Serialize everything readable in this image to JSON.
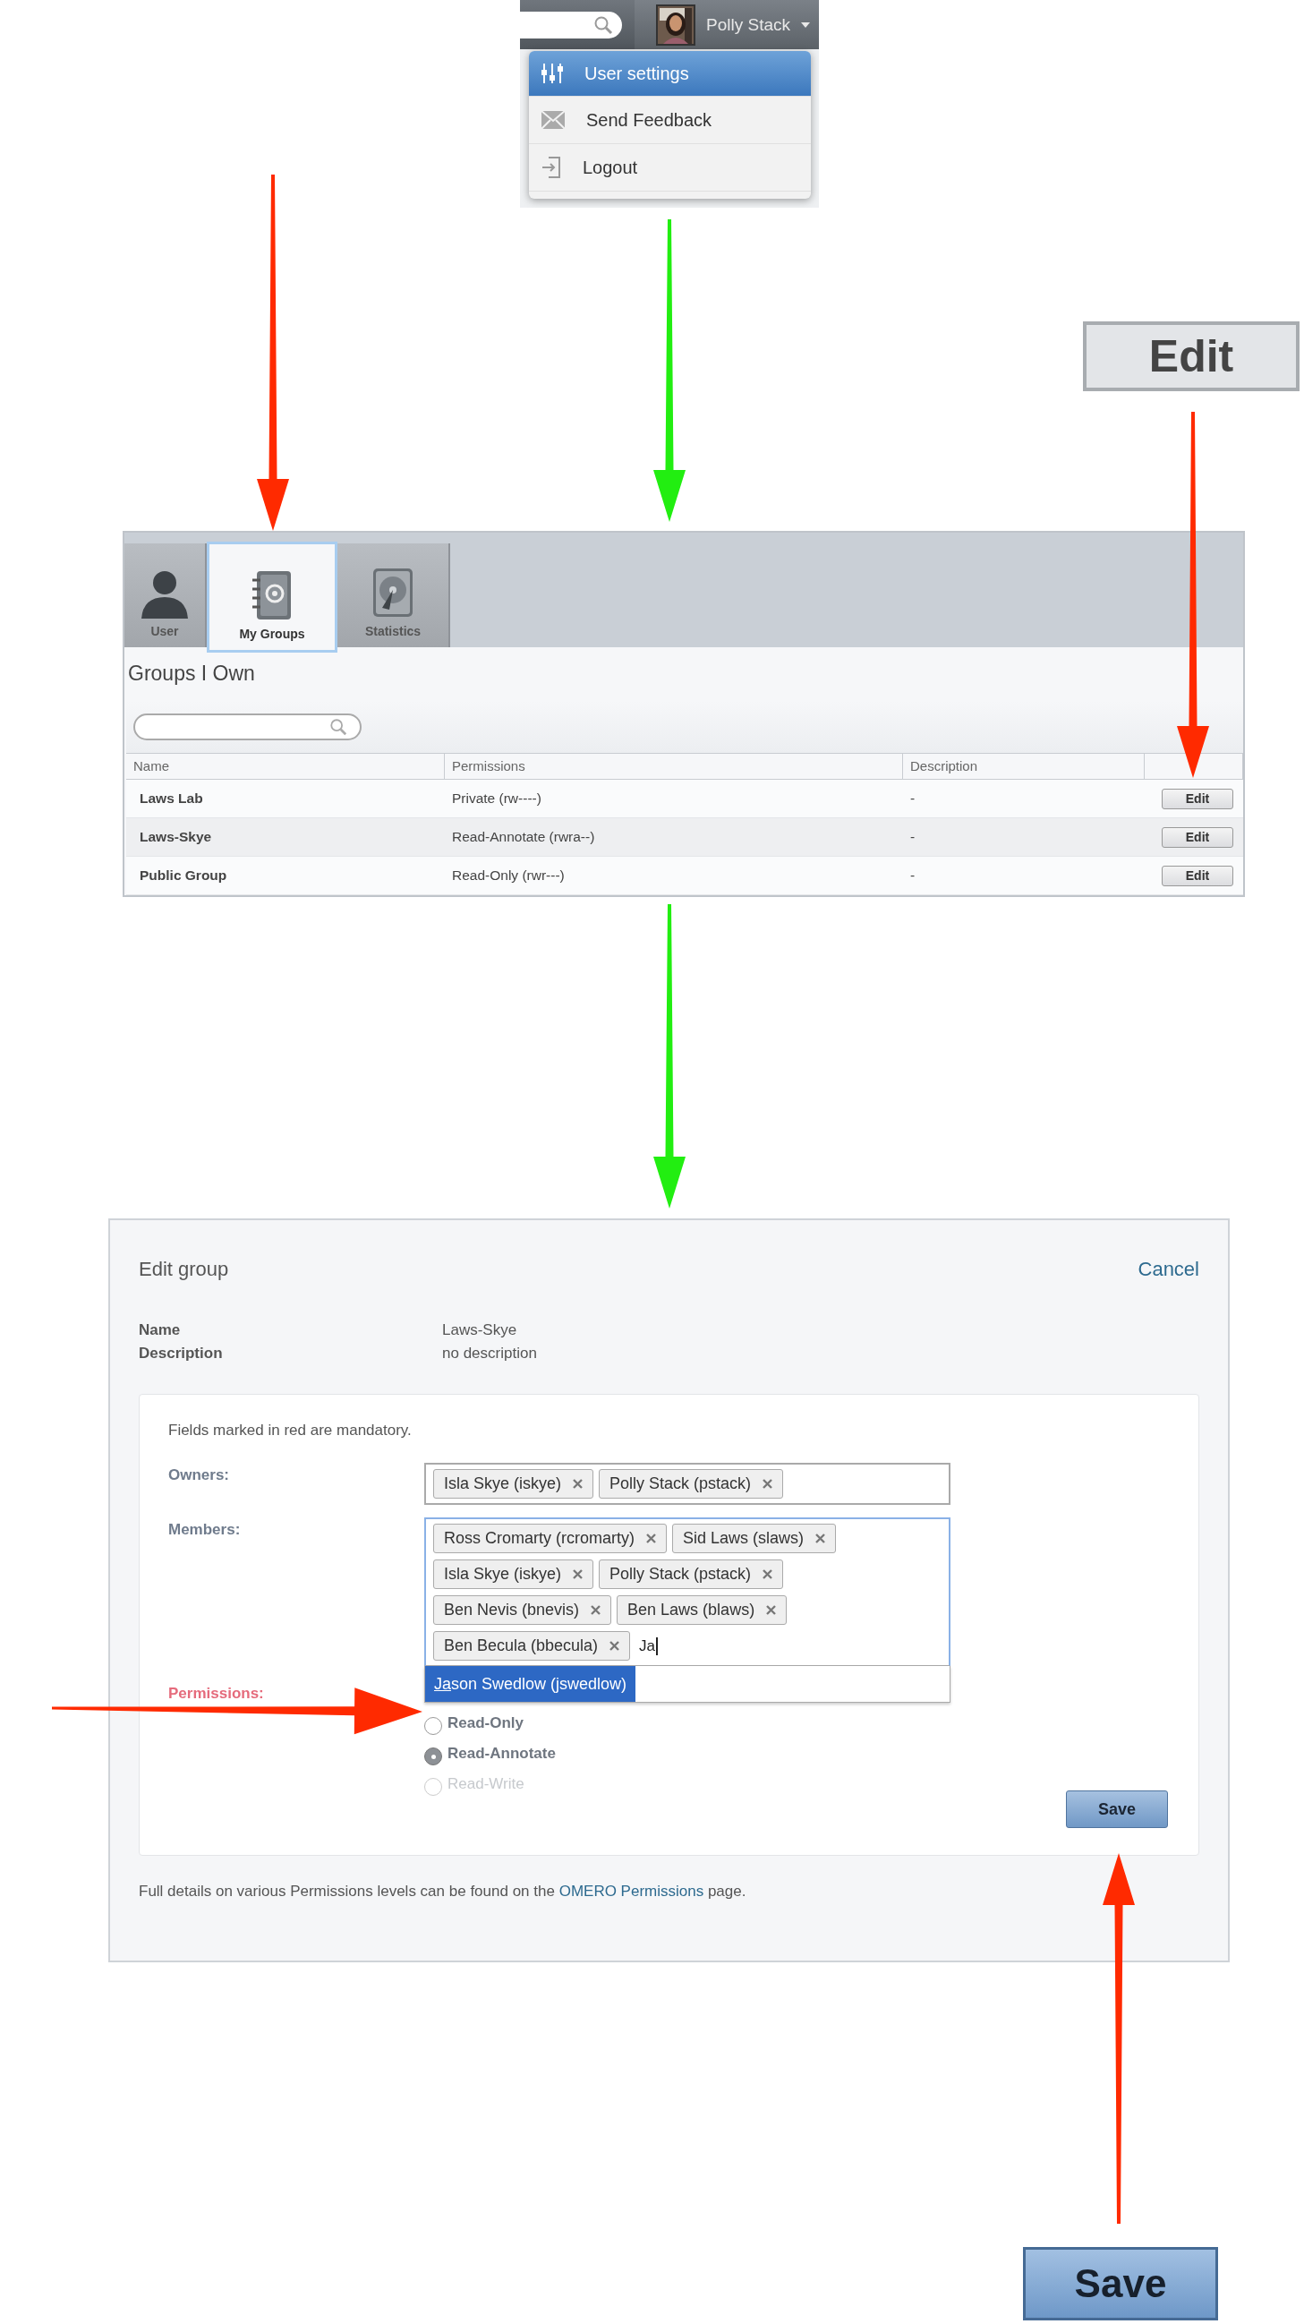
{
  "top_bar": {
    "user_name": "Polly Stack"
  },
  "user_menu": [
    {
      "kind": "sliders",
      "label": "User settings",
      "selected": true
    },
    {
      "kind": "envelope",
      "label": "Send Feedback",
      "selected": false
    },
    {
      "kind": "logout",
      "label": "Logout",
      "selected": false
    }
  ],
  "zoomed_edit_button": "Edit",
  "settings_tabs": [
    {
      "kind": "user",
      "label": "User",
      "selected": false
    },
    {
      "kind": "groups",
      "label": "My Groups",
      "selected": true
    },
    {
      "kind": "statistics",
      "label": "Statistics",
      "selected": false
    }
  ],
  "groups": {
    "title": "Groups I Own",
    "columns": [
      "Name",
      "Permissions",
      "Description"
    ],
    "rows": [
      {
        "name": "Laws Lab",
        "permissions": "Private (rw----)",
        "description": "-",
        "action": "Edit"
      },
      {
        "name": "Laws-Skye",
        "permissions": "Read-Annotate (rwra--)",
        "description": "-",
        "action": "Edit"
      },
      {
        "name": "Public Group",
        "permissions": "Read-Only (rwr---)",
        "description": "-",
        "action": "Edit"
      }
    ]
  },
  "edit_group": {
    "title": "Edit group",
    "cancel": "Cancel",
    "details": [
      {
        "label": "Name",
        "value": "Laws-Skye"
      },
      {
        "label": "Description",
        "value": "no description"
      }
    ],
    "hint": "Fields marked in red are mandatory.",
    "owners": {
      "label": "Owners:",
      "mandatory": false,
      "tags": [
        "Isla Skye (iskye)",
        "Polly Stack (pstack)"
      ]
    },
    "members": {
      "label": "Members:",
      "mandatory": false,
      "tags": [
        "Ross Cromarty (rcromarty)",
        "Sid Laws (slaws)",
        "Isla Skye (iskye)",
        "Polly Stack (pstack)",
        "Ben Nevis (bnevis)",
        "Ben Laws (blaws)",
        "Ben Becula (bbecula)"
      ],
      "value": "Ja"
    },
    "suggestion": {
      "matched": "Ja",
      "rest": "son Swedlow (jswedlow)",
      "selected": true
    },
    "permissions": {
      "label": "Permissions:",
      "mandatory": true,
      "options": [
        {
          "label": "Read-Only",
          "selected": false,
          "disabled": false
        },
        {
          "label": "Read-Annotate",
          "selected": true,
          "disabled": false
        },
        {
          "label": "Read-Write",
          "selected": false,
          "disabled": true
        }
      ]
    },
    "save": "Save",
    "footer": {
      "before": "Full details on various Permissions levels can be found on the ",
      "link": "OMERO Permissions",
      "after": " page."
    }
  },
  "zoomed_save_button": "Save"
}
